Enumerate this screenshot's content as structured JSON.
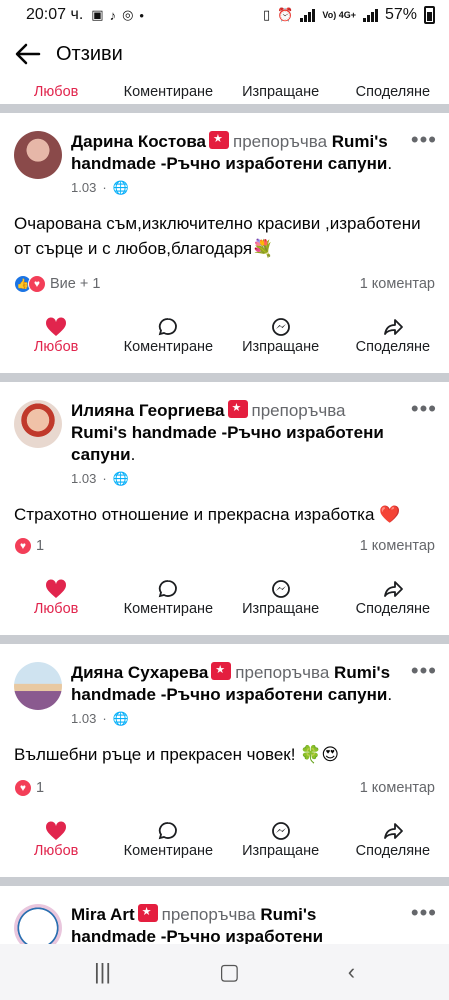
{
  "status_bar": {
    "time": "20:07 ч.",
    "network": "Vo) 4G+",
    "battery": "57%"
  },
  "header": {
    "title": "Отзиви"
  },
  "actions": {
    "love": "Любов",
    "comment": "Коментиране",
    "send": "Изпращане",
    "share": "Споделяне"
  },
  "recommends_text": "препоръчва",
  "posts": [
    {
      "name": "Дарина Костова",
      "page": "Rumi's handmade -Ръчно изработени сапуни",
      "date": "1.03",
      "text": "Очарована съм,изключително красиви ,изработени от сърце и с любов,благодаря💐",
      "reactions": "Вие + 1",
      "comments": "1 коментар",
      "avatar_color": "#c47a7a"
    },
    {
      "name": "Илияна Георгиева",
      "page": "Rumi's handmade -Ръчно изработени сапуни",
      "date": "1.03",
      "text": "Страхотно отношение и прекрасна изработка ❤️",
      "reactions": "1",
      "comments": "1 коментар",
      "avatar_color": "#d9a48a"
    },
    {
      "name": "Дияна Сухарева",
      "page": "Rumi's handmade -Ръчно изработени сапуни",
      "date": "1.03",
      "text": "Вълшебни ръце и прекрасен човек! 🍀😍",
      "reactions": "1",
      "comments": "1 коментар",
      "avatar_color": "#8fb7d6"
    },
    {
      "name": "Mira Art",
      "page": "Rumi's handmade -Ръчно изработени",
      "avatar_color": "#e9c6dd"
    }
  ]
}
